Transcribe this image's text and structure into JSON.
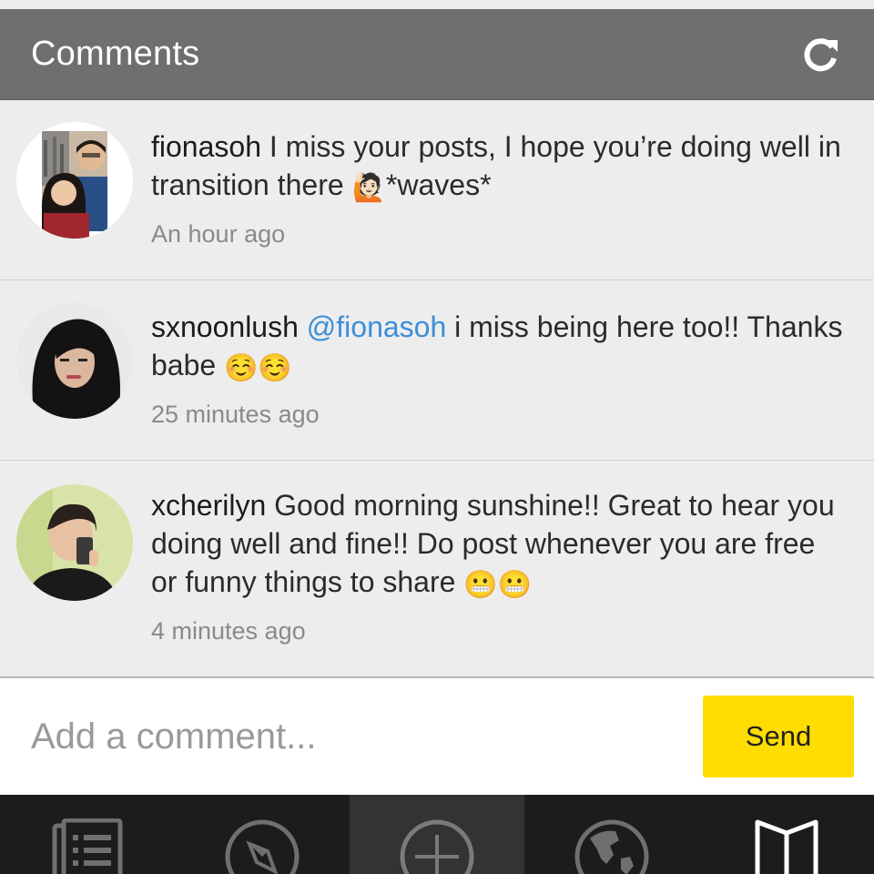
{
  "header": {
    "title": "Comments",
    "refresh_icon": "refresh-icon"
  },
  "comments": [
    {
      "username": "fionasoh",
      "text_before": " I miss your posts, I hope you’re doing well in transition there ",
      "emoji": "🙋🏻",
      "text_after": "*waves*",
      "timestamp": "An hour ago"
    },
    {
      "username": "sxnoonlush",
      "mention": "@fionasoh",
      "text": " i miss being here too!! Thanks babe ",
      "emoji": "☺️☺️",
      "timestamp": "25 minutes ago"
    },
    {
      "username": "xcherilyn",
      "text": " Good morning sunshine!! Great to hear you doing well and fine!! Do post whenever you are free or funny things to share ",
      "emoji": "😬😬",
      "timestamp": "4 minutes ago"
    }
  ],
  "input": {
    "placeholder": "Add a comment...",
    "value": "",
    "send_label": "Send"
  },
  "nav": {
    "items": [
      {
        "icon": "feed-icon",
        "active": false
      },
      {
        "icon": "compass-icon",
        "active": false
      },
      {
        "icon": "add-icon",
        "active": true
      },
      {
        "icon": "globe-icon",
        "active": false
      },
      {
        "icon": "book-icon",
        "active": false
      }
    ]
  },
  "colors": {
    "header_bg": "#6f6f6f",
    "list_bg": "#ededed",
    "mention": "#3a8fd9",
    "send_button": "#ffdd00",
    "nav_bg": "#1c1c1c",
    "nav_active_bg": "#333333"
  }
}
